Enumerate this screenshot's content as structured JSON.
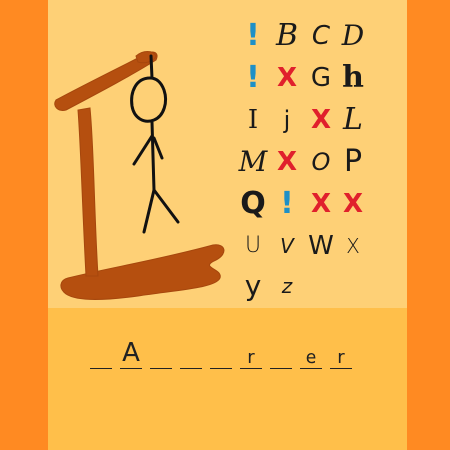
{
  "word_slots": [
    {
      "char": ""
    },
    {
      "char": "A"
    },
    {
      "char": ""
    },
    {
      "char": ""
    },
    {
      "char": ""
    },
    {
      "char": "r"
    },
    {
      "char": ""
    },
    {
      "char": "e"
    },
    {
      "char": "r"
    }
  ],
  "letter_grid": [
    [
      "!",
      "B",
      "C",
      "D"
    ],
    [
      "!",
      "X",
      "G",
      "h"
    ],
    [
      "I",
      "j",
      "X",
      "L"
    ],
    [
      "M",
      "X",
      "O",
      "P"
    ],
    [
      "Q",
      "!",
      "X",
      "X"
    ],
    [
      "U",
      "V",
      "W",
      "X"
    ],
    [
      "y",
      "z"
    ]
  ],
  "colors": {
    "background": "#ff8a22",
    "panel": "#fed076",
    "answer_panel": "#ffbf4a",
    "gallows_wood": "#b54f0f",
    "wrong_mark": "#e0202c",
    "used_mark": "#1e90c7"
  },
  "icons": [
    "gallows-drawing",
    "hangman-figure",
    "wrong-x-icon",
    "exclamation-icon"
  ]
}
